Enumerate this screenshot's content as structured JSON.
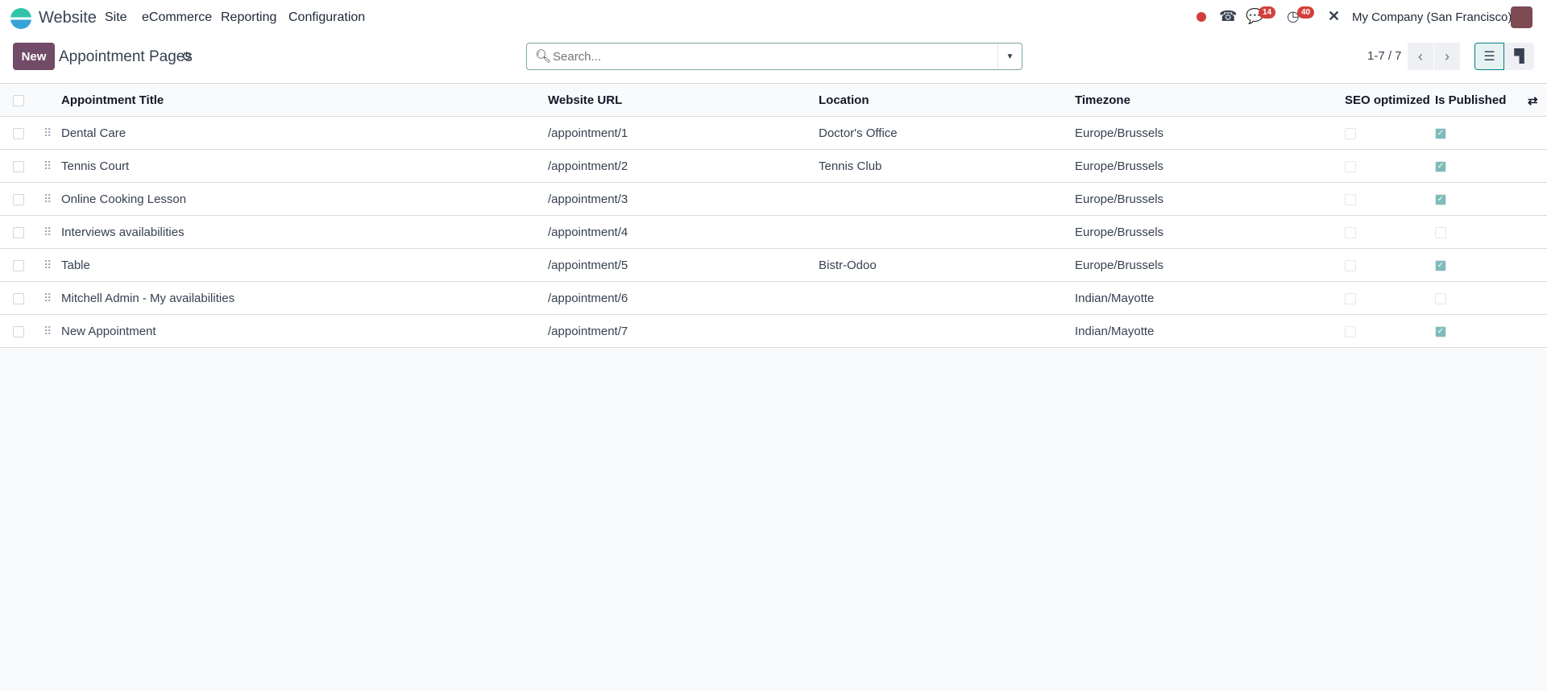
{
  "topbar": {
    "app": "Website",
    "menu": [
      "Site",
      "eCommerce",
      "Reporting",
      "Configuration"
    ],
    "messages_count": "14",
    "activities_count": "40",
    "company": "My Company (San Francisco)"
  },
  "control": {
    "new_label": "New",
    "title": "Appointment Pages",
    "search_placeholder": "Search...",
    "pager": "1-7 / 7"
  },
  "columns": [
    "Appointment Title",
    "Website URL",
    "Location",
    "Timezone",
    "SEO optimized",
    "Is Published"
  ],
  "rows": [
    {
      "title": "Dental Care",
      "url": "/appointment/1",
      "location": "Doctor's Office",
      "tz": "Europe/Brussels",
      "seo": false,
      "published": true
    },
    {
      "title": "Tennis Court",
      "url": "/appointment/2",
      "location": "Tennis Club",
      "tz": "Europe/Brussels",
      "seo": false,
      "published": true
    },
    {
      "title": "Online Cooking Lesson",
      "url": "/appointment/3",
      "location": "",
      "tz": "Europe/Brussels",
      "seo": false,
      "published": true
    },
    {
      "title": "Interviews availabilities",
      "url": "/appointment/4",
      "location": "",
      "tz": "Europe/Brussels",
      "seo": false,
      "published": false
    },
    {
      "title": "Table",
      "url": "/appointment/5",
      "location": "Bistr-Odoo",
      "tz": "Europe/Brussels",
      "seo": false,
      "published": true
    },
    {
      "title": "Mitchell Admin - My availabilities",
      "url": "/appointment/6",
      "location": "",
      "tz": "Indian/Mayotte",
      "seo": false,
      "published": false
    },
    {
      "title": "New Appointment",
      "url": "/appointment/7",
      "location": "",
      "tz": "Indian/Mayotte",
      "seo": false,
      "published": true
    }
  ],
  "colors": {
    "brand": "#714b67",
    "accent": "#7ebcba",
    "badge": "#d23f3a"
  }
}
